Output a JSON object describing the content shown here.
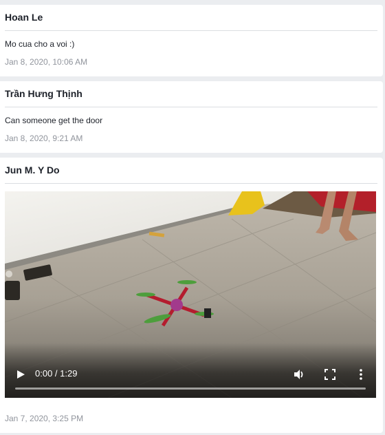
{
  "posts": [
    {
      "author": "Hoan Le",
      "message": "Mo cua cho a voi :)",
      "timestamp": "Jan 8, 2020, 10:06 AM"
    },
    {
      "author": "Trần Hưng Thịnh",
      "message": "Can someone get the door",
      "timestamp": "Jan 8, 2020, 9:21 AM"
    },
    {
      "author": "Jun M. Y Do",
      "timestamp": "Jan 7, 2020, 3:25 PM",
      "video": {
        "time_display": "0:00 / 1:29",
        "progress_fraction": 0,
        "play_icon": "play-icon",
        "volume_icon": "volume-icon",
        "fullscreen_icon": "fullscreen-icon",
        "more_icon": "more-vertical-icon"
      }
    }
  ],
  "colors": {
    "background": "#ebedf0",
    "card": "#ffffff",
    "text": "#1d2129",
    "muted": "#90949c",
    "divider": "#dadde1"
  }
}
